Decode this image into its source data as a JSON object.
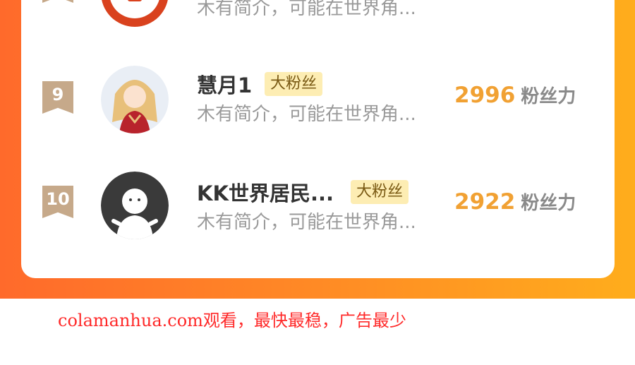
{
  "ranking": {
    "top_row": {
      "bio": "木有简介，可能在世界角..."
    },
    "rows": [
      {
        "rank": "9",
        "name": "慧月1",
        "badge": "大粉丝",
        "bio": "木有简介，可能在世界角...",
        "score": "2996",
        "score_unit": "粉丝力"
      },
      {
        "rank": "10",
        "name": "KK世界居民...",
        "badge": "大粉丝",
        "bio": "木有简介，可能在世界角...",
        "score": "2922",
        "score_unit": "粉丝力"
      }
    ]
  },
  "footer": {
    "watermark": "colamanhua.com观看，最快最稳，广告最少"
  },
  "colors": {
    "accent_gradient_start": "#ff6a2b",
    "accent_gradient_end": "#ffad1c",
    "score": "#f1a133",
    "badge_bg": "#fdedb3",
    "footer_text": "#ff2a2a"
  }
}
